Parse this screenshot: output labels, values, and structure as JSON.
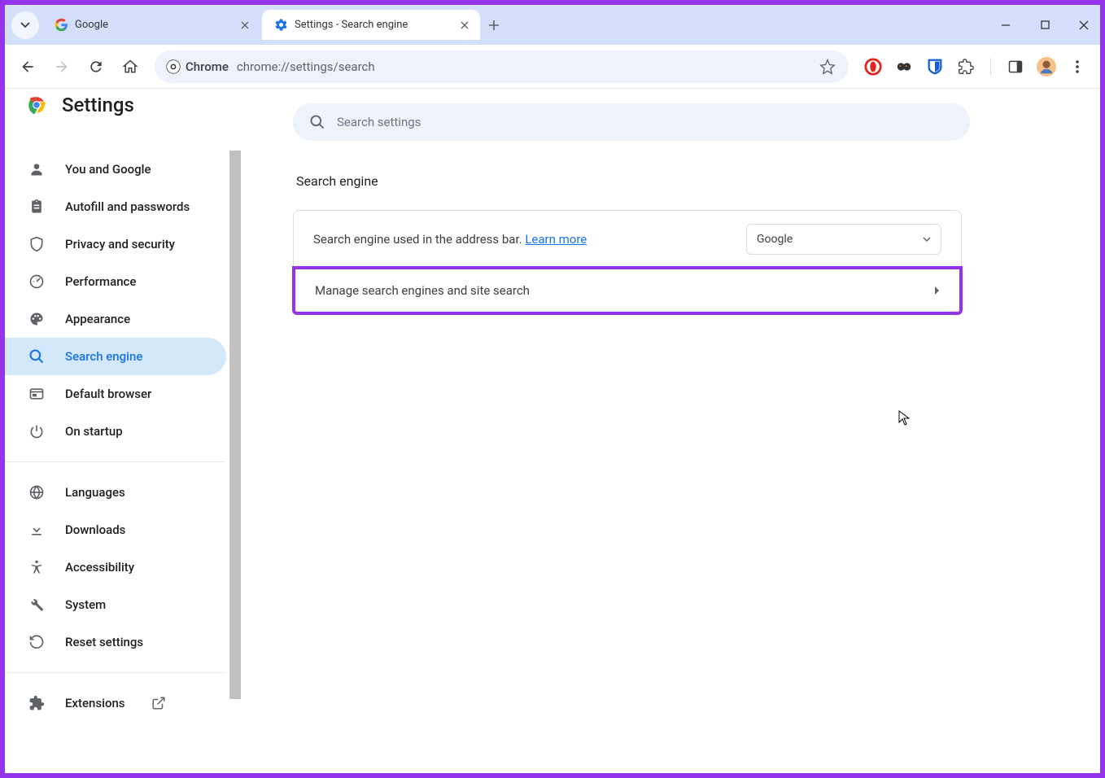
{
  "tabs": [
    {
      "title": "Google"
    },
    {
      "title": "Settings - Search engine"
    }
  ],
  "address": {
    "chip_label": "Chrome",
    "url": "chrome://settings/search"
  },
  "settings_title": "Settings",
  "search_placeholder": "Search settings",
  "sidebar": {
    "items1": [
      {
        "label": "You and Google"
      },
      {
        "label": "Autofill and passwords"
      },
      {
        "label": "Privacy and security"
      },
      {
        "label": "Performance"
      },
      {
        "label": "Appearance"
      },
      {
        "label": "Search engine"
      },
      {
        "label": "Default browser"
      },
      {
        "label": "On startup"
      }
    ],
    "items2": [
      {
        "label": "Languages"
      },
      {
        "label": "Downloads"
      },
      {
        "label": "Accessibility"
      },
      {
        "label": "System"
      },
      {
        "label": "Reset settings"
      }
    ],
    "items3": [
      {
        "label": "Extensions"
      }
    ]
  },
  "main": {
    "section_title": "Search engine",
    "row1_text": "Search engine used in the address bar. ",
    "row1_link": "Learn more",
    "dropdown_value": "Google",
    "row2_text": "Manage search engines and site search"
  }
}
